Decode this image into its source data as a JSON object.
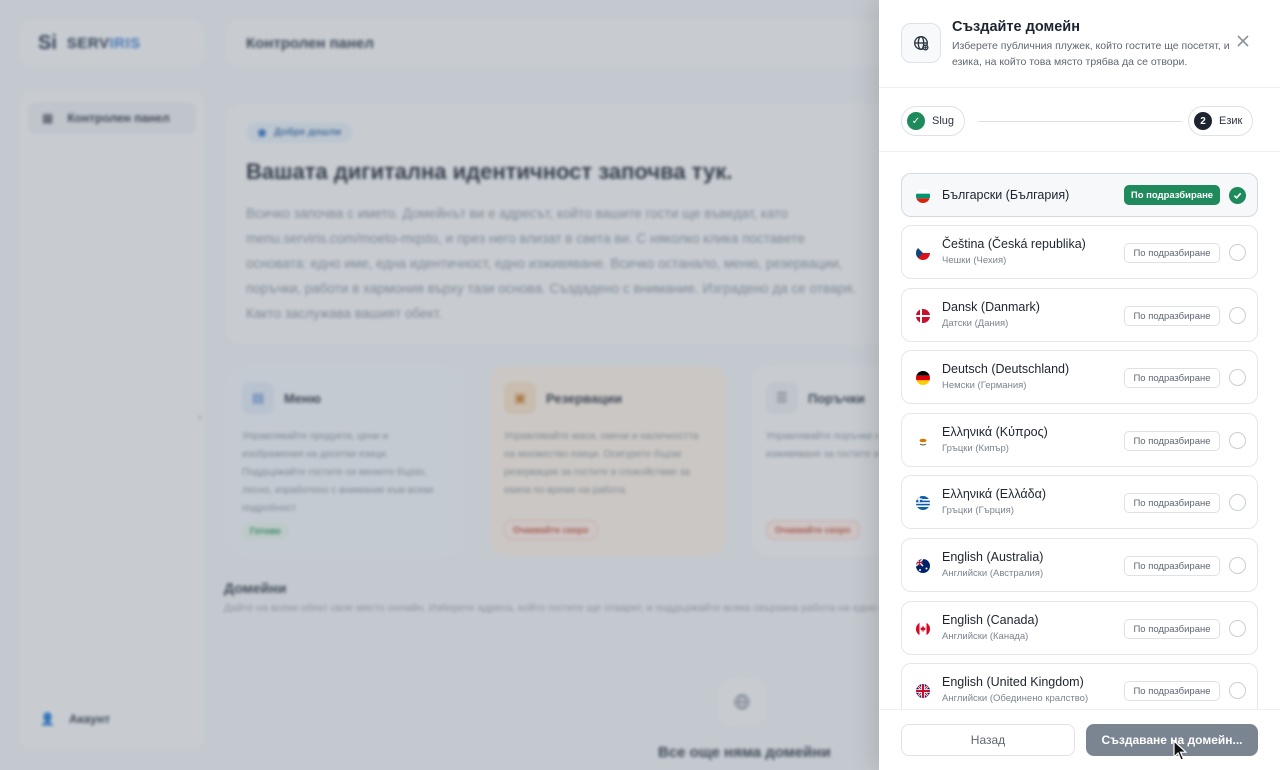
{
  "background": {
    "logo": {
      "mark": "Si",
      "brand": "SERV",
      "brand_accent": "IRIS"
    },
    "topbar_title": "Контролен панел",
    "sidebar": {
      "item": "Контролен панел",
      "account": "Акаунт"
    },
    "hero": {
      "badge": "Добре дошли",
      "title": "Вашата дигитална идентичност започва тук.",
      "text": "Всичко започва с името. Домейнът ви е адресът, който вашите гости ще въведат, като menu.serviris.com/moeto-mqsto, и през него влизат в света ви. С няколко клика поставете основата: едно име, една идентичност, едно изживяване. Всичко останало, меню, резервации, поръчки, работи в хармония върху тази основа. Създадено с внимание. Изградено да се отваря. Както заслужава вашият обект."
    },
    "cards": [
      {
        "title": "Меню",
        "text": "Управлявайте продукти, цени и изображения на десетки езици. Поддържайте гостите си менюто бързо, лесно, изработено с внимание към всеки подробност",
        "pill": "Готово"
      },
      {
        "title": "Резервации",
        "text": "Управлявайте маси, смени и наличността на множество езици. Осигурете бързи резервации за гостите и спокойствие за екипа по време на работа.",
        "pill": "Очаквайте скоро"
      },
      {
        "title": "Поръчки",
        "text": "Управлявайте поръчки на маса и доставки, изживяване за гостите и за екипа.",
        "pill": "Очаквайте скоро"
      }
    ],
    "domains_title": "Домейни",
    "domains_sub": "Дайте на всеки обект свое място онлайн. Изберете адреса, който гостите ще отварят, и поддържайте всяка свързана работа на едно място.",
    "empty_text": "Все още няма домейни"
  },
  "drawer": {
    "title": "Създайте домейн",
    "subtitle": "Изберете публичния плужек, който гостите ще посетят, и езика, на който това място трябва да се отвори.",
    "steps": [
      {
        "num": "✓",
        "label": "Slug",
        "state": "done"
      },
      {
        "num": "2",
        "label": "Език",
        "state": "current"
      }
    ],
    "default_label": "По подразбиране",
    "languages": [
      {
        "name": "Български (България)",
        "sub": "",
        "flag": "bg",
        "selected": true
      },
      {
        "name": "Čeština (Česká republika)",
        "sub": "Чешки (Чехия)",
        "flag": "cz",
        "selected": false
      },
      {
        "name": "Dansk (Danmark)",
        "sub": "Датски (Дания)",
        "flag": "dk",
        "selected": false
      },
      {
        "name": "Deutsch (Deutschland)",
        "sub": "Немски (Германия)",
        "flag": "de",
        "selected": false
      },
      {
        "name": "Ελληνικά (Κύπρος)",
        "sub": "Гръцки (Кипър)",
        "flag": "cy",
        "selected": false
      },
      {
        "name": "Ελληνικά (Ελλάδα)",
        "sub": "Гръцки (Гърция)",
        "flag": "gr",
        "selected": false
      },
      {
        "name": "English (Australia)",
        "sub": "Английски (Австралия)",
        "flag": "au",
        "selected": false
      },
      {
        "name": "English (Canada)",
        "sub": "Английски (Канада)",
        "flag": "ca",
        "selected": false
      },
      {
        "name": "English (United Kingdom)",
        "sub": "Английски (Обединено кралство)",
        "flag": "gb",
        "selected": false
      }
    ],
    "back_label": "Назад",
    "create_label": "Създаване на домейн..."
  },
  "colors": {
    "accent": "#1f8a5b",
    "disabled_button": "#7b8591"
  }
}
